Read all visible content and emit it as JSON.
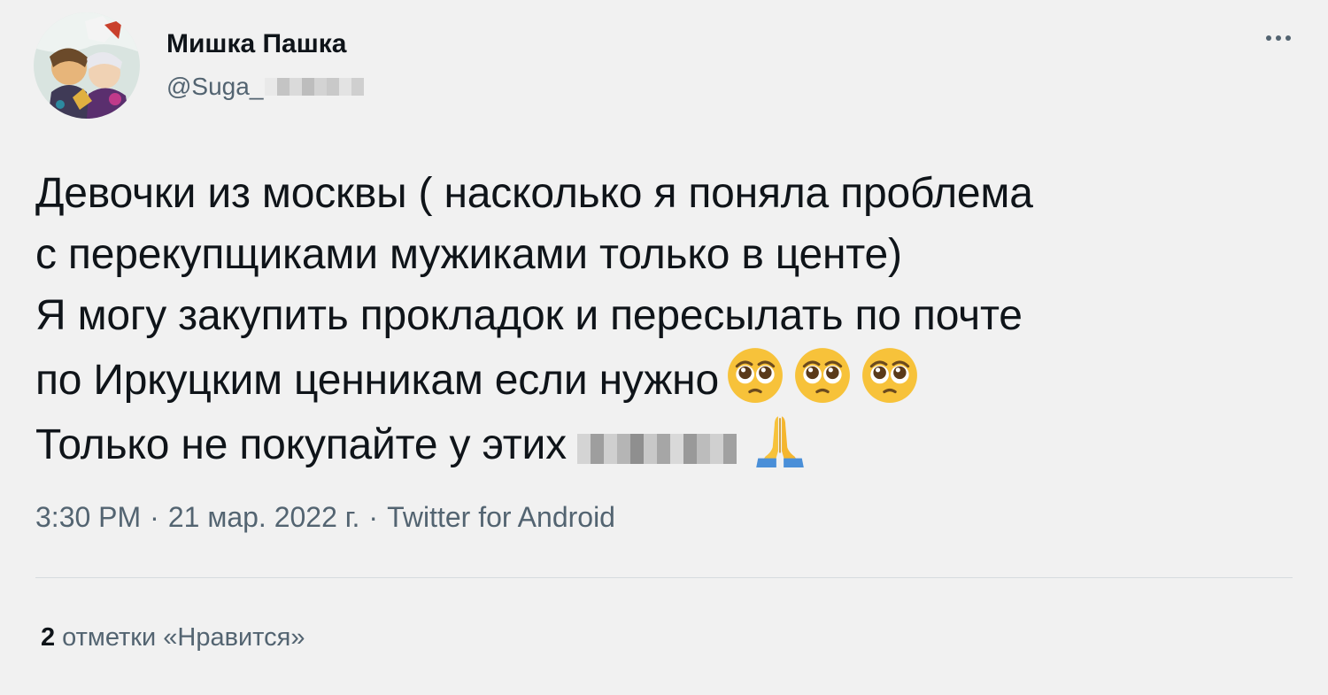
{
  "author": {
    "display_name": "Мишка Пашка",
    "handle": "@Suga_"
  },
  "tweet": {
    "lines": [
      "Девочки из москвы ( насколько я поняла проблема",
      "с перекупщиками мужиками только в центе)",
      "Я могу закупить прокладок и пересылать по почте",
      "по Иркуцким ценникам если нужно",
      "Только не покупайте у этих"
    ],
    "emoji_line4": [
      "pleading-face-icon",
      "pleading-face-icon",
      "pleading-face-icon"
    ],
    "emoji_line5": [
      "folded-hands-icon"
    ]
  },
  "meta": {
    "time": "3:30 PM",
    "separator": "·",
    "date": "21 мар. 2022 г.",
    "source": "Twitter for Android"
  },
  "likes": {
    "count": "2",
    "label": "отметки «Нравится»"
  },
  "colors": {
    "background": "#f1f1f1",
    "text": "#0f1419",
    "secondary_text": "#536471",
    "divider": "#d6dbdf"
  }
}
